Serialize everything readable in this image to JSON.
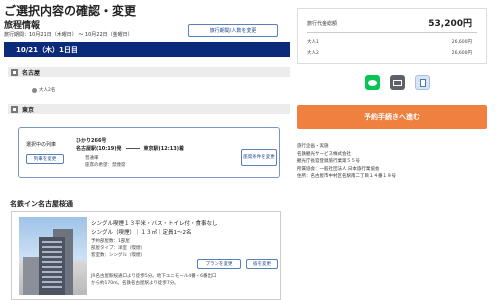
{
  "header": {
    "title": "ご選択内容の確認・変更",
    "section": "旅程情報",
    "period": "旅行期間：10月21日（木曜日） 〜 10月22日（金曜日）",
    "change_dates_label": "旅行期間/人数を変更"
  },
  "day": {
    "label": "10/21（木）1日目"
  },
  "places": {
    "origin": "名古屋",
    "destination": "東京"
  },
  "party": {
    "adults": "大人2名"
  },
  "train": {
    "selected_label": "選択中の列車",
    "change_label": "列車を変更",
    "name": "ひかり266号",
    "from": "名古屋駅(10:19)発",
    "to": "東京駅(12:13)着",
    "class": "普通車",
    "smoking": "座席の希望：禁煙席",
    "seat_change_label": "座席条件を変更"
  },
  "hotel": {
    "name": "名鉄イン名古屋桜通",
    "room_name": "シングル喫煙１３平米・バス・トイレ付・食事なし",
    "room_plan": "シングル（喫煙）｜１３㎡｜定員1〜2名",
    "details": [
      "予約部屋数：1部屋",
      "部屋タイプ：洋室（喫煙）",
      "客室数：シングル（喫煙）",
      "JR名古屋駅桜通口より徒歩5分。地下ユニモール4番・6番出口",
      "から約170m。名鉄名古屋駅より徒歩7分。"
    ],
    "plan_change_label": "プランを変更",
    "hotel_change_label": "宿を変更"
  },
  "price": {
    "label": "旅行代金総額",
    "total": "53,200円",
    "lines": [
      {
        "label": "大人1",
        "value": "26,600円"
      },
      {
        "label": "大人2",
        "value": "26,600円"
      }
    ]
  },
  "share": {
    "icons": [
      "line-icon",
      "mail-icon",
      "copy-icon"
    ]
  },
  "actions": {
    "proceed_label": "予約手続きへ進む"
  },
  "company": {
    "lines": [
      "旅行企画・実施",
      "名鉄観光サービス株式会社",
      "観光庁長官登録旅行業第５５号",
      "所属協会：一般社団法人 日本旅行業協会",
      "住所：名古屋市中村区名駅南二丁目１４番１９号"
    ]
  }
}
